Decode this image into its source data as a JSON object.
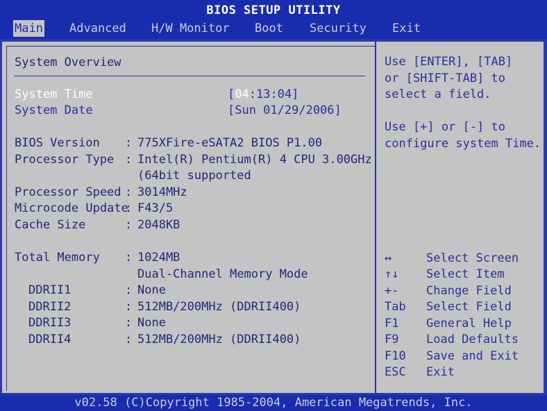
{
  "title": "BIOS SETUP UTILITY",
  "menu": [
    "Main",
    "Advanced",
    "H/W Monitor",
    "Boot",
    "Security",
    "Exit"
  ],
  "active_menu": "Main",
  "section_title": "System Overview",
  "system_time": {
    "label": "System Time",
    "hour": "04",
    "rest": ":13:04]",
    "open": "["
  },
  "system_date": {
    "label": "System Date",
    "value": "[Sun 01/29/2006]"
  },
  "info": [
    {
      "label": "BIOS Version",
      "sep": ":",
      "value": "775XFire-eSATA2 BIOS P1.00"
    },
    {
      "label": "Processor Type",
      "sep": ":",
      "value": "Intel(R) Pentium(R) 4 CPU 3.00GHz"
    },
    {
      "label": "",
      "sep": "",
      "value": "(64bit supported"
    },
    {
      "label": "Processor Speed",
      "sep": ":",
      "value": "3014MHz"
    },
    {
      "label": "Microcode Update",
      "sep": ":",
      "value": "F43/5"
    },
    {
      "label": "Cache Size",
      "sep": ":",
      "value": "2048KB"
    }
  ],
  "memory": [
    {
      "label": "Total Memory",
      "sep": ":",
      "value": "1024MB"
    },
    {
      "label": "",
      "sep": "",
      "value": "Dual-Channel Memory Mode"
    },
    {
      "label": "DDRII1",
      "sep": ":",
      "value": "None"
    },
    {
      "label": "DDRII2",
      "sep": ":",
      "value": "512MB/200MHz (DDRII400)"
    },
    {
      "label": "DDRII3",
      "sep": ":",
      "value": "None"
    },
    {
      "label": "DDRII4",
      "sep": ":",
      "value": "512MB/200MHz (DDRII400)"
    }
  ],
  "help": [
    "Use [ENTER], [TAB]",
    "or [SHIFT-TAB] to",
    "select a field.",
    "",
    "Use [+] or [-] to",
    "configure system Time."
  ],
  "keys": [
    {
      "key": "↔",
      "action": "Select Screen"
    },
    {
      "key": "↑↓",
      "action": "Select Item"
    },
    {
      "key": "+-",
      "action": "Change Field"
    },
    {
      "key": "Tab",
      "action": "Select Field"
    },
    {
      "key": "F1",
      "action": "General Help"
    },
    {
      "key": "F9",
      "action": "Load Defaults"
    },
    {
      "key": "F10",
      "action": "Save and Exit"
    },
    {
      "key": "ESC",
      "action": "Exit"
    }
  ],
  "footer": "v02.58 (C)Copyright 1985-2004, American Megatrends, Inc."
}
